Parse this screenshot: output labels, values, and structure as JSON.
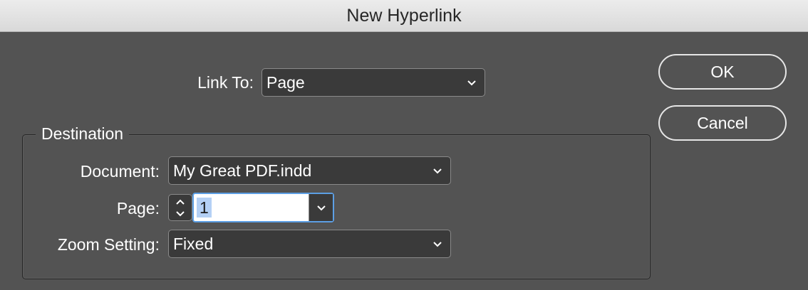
{
  "window": {
    "title": "New Hyperlink"
  },
  "link_to": {
    "label": "Link To:",
    "value": "Page"
  },
  "buttons": {
    "ok": "OK",
    "cancel": "Cancel"
  },
  "destination": {
    "legend": "Destination",
    "document": {
      "label": "Document:",
      "value": "My Great PDF.indd"
    },
    "page": {
      "label": "Page:",
      "value": "1"
    },
    "zoom": {
      "label": "Zoom Setting:",
      "value": "Fixed"
    }
  },
  "colors": {
    "background": "#535353",
    "field": "#3a3a3a",
    "focus": "#5c9fe4",
    "selection": "#b4d0f5"
  },
  "icons": {
    "dropdown": "chevron-down-icon",
    "stepper_up": "chevron-up-icon",
    "stepper_down": "chevron-down-icon"
  }
}
